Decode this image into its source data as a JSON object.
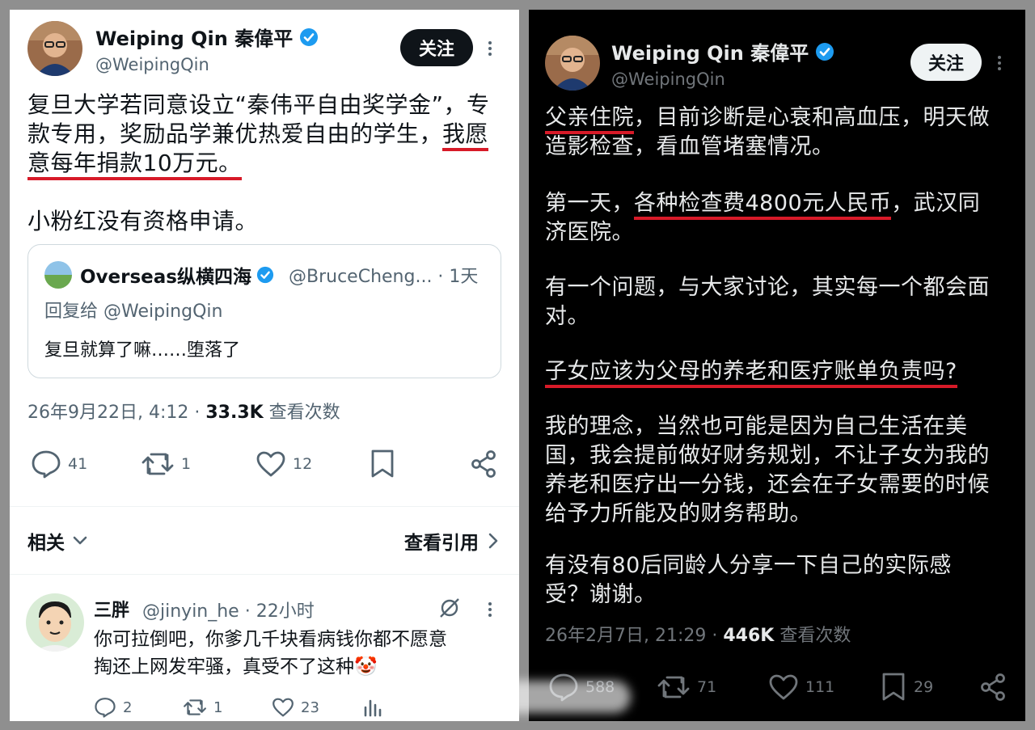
{
  "left_post": {
    "author_name": "Weiping Qin 秦偉平",
    "author_handle": "@WeipingQin",
    "follow_label": "关注",
    "text_lines": [
      {
        "pre": "复旦大学若同意设立“秦伟平自由奖学金”，专",
        "mark": ""
      },
      {
        "pre": "款专用，奖励品学兼优热爱自由的学生，",
        "mark": "我愿"
      },
      {
        "pre": "",
        "mark": "意每年捐款10万元。"
      }
    ],
    "text2": "小粉红没有资格申请。",
    "quote": {
      "author_name": "Overseas纵横四海",
      "author_handle": "@BruceCheng... · 1天",
      "reply_to": "回复给 @WeipingQin",
      "text": "复旦就算了嘛……堕落了"
    },
    "timestamp": "26年9月22日, 4:12 · ",
    "views_count": "33.3K",
    "views_label": " 查看次数",
    "stats": {
      "replies": "41",
      "reposts": "1",
      "likes": "12"
    },
    "related_label": "相关",
    "view_quotes_label": "查看引用",
    "reply": {
      "author_name": "三胖",
      "author_handle": "@jinyin_he · 22小时",
      "text_line1": "你可拉倒吧，你爹几千块看病钱你都不愿意",
      "text_line2": "掏还上网发牢骚，真受不了这种🤡",
      "stats": {
        "replies": "2",
        "reposts": "1",
        "likes": "23"
      }
    }
  },
  "right_post": {
    "author_name": "Weiping Qin 秦偉平",
    "author_handle": "@WeipingQin",
    "follow_label": "关注",
    "para1_mark": "父亲住院",
    "para1_rest1": "，目前诊断是心衰和高血压，明天做",
    "para1_rest2": "造影检查，看血管堵塞情况。",
    "para2_pre": "第一天，",
    "para2_mark": "各种检查费4800元人民币",
    "para2_post": "，武汉同",
    "para2_rest": "济医院。",
    "para3_line1": "有一个问题，与大家讨论，其实每一个都会面",
    "para3_line2": "对。",
    "para4_mark": "子女应该为父母的养老和医疗账单负责吗?",
    "para5_line1": "我的理念，当然也可能是因为自己生活在美",
    "para5_line2": "国，我会提前做好财务规划，不让子女为我的",
    "para5_line3": "养老和医疗出一分钱，还会在子女需要的时候",
    "para5_line4": "给予力所能及的财务帮助。",
    "para6_line1": "有没有80后同龄人分享一下自己的实际感",
    "para6_line2": "受？谢谢。",
    "timestamp": "26年2月7日, 21:29 · ",
    "views_count": "446K",
    "views_label": " 查看次数",
    "stats": {
      "replies": "588",
      "reposts": "71",
      "likes": "111",
      "bookmarks": "29"
    }
  },
  "colors": {
    "underline": "#d71a28",
    "verified": "#1d9bf0"
  },
  "icons": [
    "verified-badge-icon",
    "more-icon",
    "reply-icon",
    "repost-icon",
    "like-icon",
    "bookmark-icon",
    "share-icon",
    "chevron-down-icon",
    "chevron-right-icon",
    "hide-icon",
    "analytics-icon"
  ]
}
